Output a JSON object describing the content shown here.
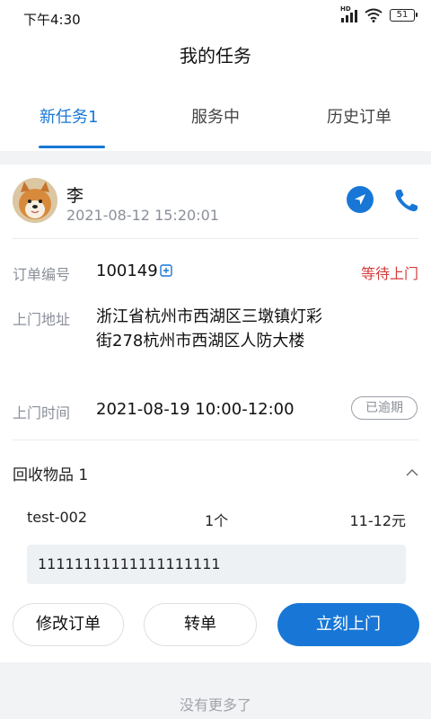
{
  "status_bar": {
    "time": "下午4:30",
    "battery": "51"
  },
  "header": {
    "title": "我的任务"
  },
  "tabs": [
    {
      "label": "新任务1",
      "active": true
    },
    {
      "label": "服务中",
      "active": false
    },
    {
      "label": "历史订单",
      "active": false
    }
  ],
  "task": {
    "customer_name": "李",
    "created_time": "2021-08-12 15:20:01",
    "order_no_label": "订单编号",
    "order_no": "100149",
    "status": "等待上门",
    "address_label": "上门地址",
    "address": "浙江省杭州市西湖区三墩镇灯彩街278杭州市西湖区人防大楼",
    "visit_time_label": "上门时间",
    "visit_time": "2021-08-19 10:00-12:00",
    "overdue_badge": "已逾期",
    "items_title": "回收物品 1",
    "items": [
      {
        "name": "test-002",
        "qty": "1个",
        "price": "11-12元"
      }
    ],
    "remark": "11111111111111111111"
  },
  "actions": {
    "modify": "修改订单",
    "transfer": "转单",
    "visit_now": "立刻上门"
  },
  "footer": {
    "no_more": "没有更多了"
  },
  "colors": {
    "accent": "#1877d6",
    "status_red": "#d73b3b"
  }
}
